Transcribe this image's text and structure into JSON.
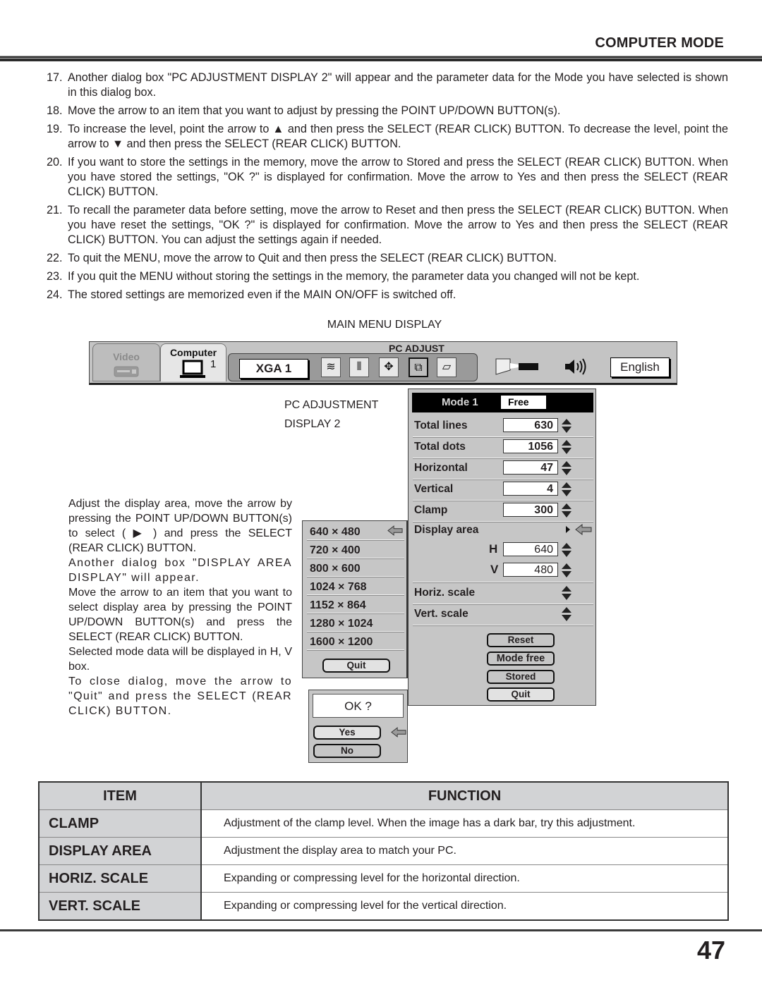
{
  "header": {
    "section_title": "COMPUTER MODE"
  },
  "steps": [
    {
      "num": "17.",
      "text": "Another dialog box \"PC ADJUSTMENT DISPLAY 2\" will appear and the parameter data for the Mode you have selected is shown in this dialog box."
    },
    {
      "num": "18.",
      "text": "Move the arrow to an item that you want to adjust by pressing the POINT UP/DOWN BUTTON(s)."
    },
    {
      "num": "19.",
      "text": "To increase the level, point the arrow to ▲ and then press the SELECT (REAR CLICK) BUTTON. To decrease the level, point the arrow to ▼ and then press the SELECT (REAR CLICK) BUTTON."
    },
    {
      "num": "20.",
      "text": "If you want to store the settings in the memory, move the arrow to Stored and press the SELECT (REAR CLICK) BUTTON. When you have stored the settings, \"OK ?\" is displayed for confirmation. Move the arrow to Yes and then press the SELECT (REAR CLICK) BUTTON."
    },
    {
      "num": "21.",
      "text": "To recall the parameter data before setting, move the arrow to Reset and then press the SELECT (REAR CLICK) BUTTON. When you have reset the settings, \"OK ?\" is displayed for confirmation. Move the arrow to Yes and then press the SELECT (REAR CLICK) BUTTON. You can adjust the settings again if needed."
    },
    {
      "num": "22.",
      "text": "To quit the MENU, move the arrow to Quit and then press the SELECT (REAR CLICK) BUTTON."
    },
    {
      "num": "23.",
      "text": "If you quit the MENU without storing the settings in the memory, the parameter data you changed will not be kept."
    },
    {
      "num": "24.",
      "text": "The stored settings are memorized even if the MAIN ON/OFF is switched off."
    }
  ],
  "captions": {
    "main_menu": "MAIN MENU DISPLAY",
    "pc_adjustment_line1": "PC ADJUSTMENT",
    "pc_adjustment_line2": "DISPLAY 2"
  },
  "main_menu": {
    "tab_video": "Video",
    "tab_computer": "Computer",
    "computer_input_number": "1",
    "pc_adjust_label": "PC ADJUST",
    "mode_name": "XGA 1",
    "language": "English",
    "icons": [
      "auto-pc-adjustment-icon",
      "fine-sync-icon",
      "position-icon",
      "pc-adjustment-display-icon",
      "screen-icon",
      "projector-image-icon",
      "sound-icon"
    ]
  },
  "pc_adjustment_display": {
    "mode_label": "Mode 1",
    "mode_value": "Free",
    "params": [
      {
        "label": "Total lines",
        "value": "630"
      },
      {
        "label": "Total dots",
        "value": "1056"
      },
      {
        "label": "Horizontal",
        "value": "47"
      },
      {
        "label": "Vertical",
        "value": "4"
      },
      {
        "label": "Clamp",
        "value": "300"
      }
    ],
    "display_area_label": "Display area",
    "h_label": "H",
    "h_value": "640",
    "v_label": "V",
    "v_value": "480",
    "horiz_scale_label": "Horiz. scale",
    "vert_scale_label": "Vert. scale",
    "buttons": {
      "reset": "Reset",
      "mode_free": "Mode free",
      "stored": "Stored",
      "quit": "Quit"
    }
  },
  "display_area_dialog": {
    "options": [
      "640 × 480",
      "720 × 400",
      "800 × 600",
      "1024 × 768",
      "1152 × 864",
      "1280 × 1024",
      "1600 × 1200"
    ],
    "selected": "640 × 480",
    "quit": "Quit"
  },
  "ok_dialog": {
    "prompt": "OK ?",
    "yes": "Yes",
    "no": "No"
  },
  "explanation": {
    "p1": "Adjust the display area, move the arrow by pressing the POINT UP/DOWN BUTTON(s) to select ( ▶ ) and press the SELECT (REAR CLICK) BUTTON.",
    "p2": "Another dialog box \"DISPLAY AREA DISPLAY\" will appear.",
    "p3": "Move the arrow to an item that you want to select display area by pressing the POINT UP/DOWN BUTTON(s) and press the SELECT (REAR CLICK) BUTTON.",
    "p4": "Selected mode data will be displayed in H, V box.",
    "p5": "To close dialog, move the arrow to \"Quit\" and press the SELECT (REAR CLICK) BUTTON."
  },
  "function_table": {
    "headers": {
      "item": "ITEM",
      "function": "FUNCTION"
    },
    "rows": [
      {
        "item": "CLAMP",
        "function": "Adjustment of the clamp level. When the image has a dark bar, try this adjustment."
      },
      {
        "item": "DISPLAY AREA",
        "function": "Adjustment the display area to match your PC."
      },
      {
        "item": "HORIZ. SCALE",
        "function": "Expanding or compressing level for the horizontal direction."
      },
      {
        "item": "VERT. SCALE",
        "function": "Expanding or compressing level for the vertical direction."
      }
    ]
  },
  "footer": {
    "page_number": "47"
  }
}
